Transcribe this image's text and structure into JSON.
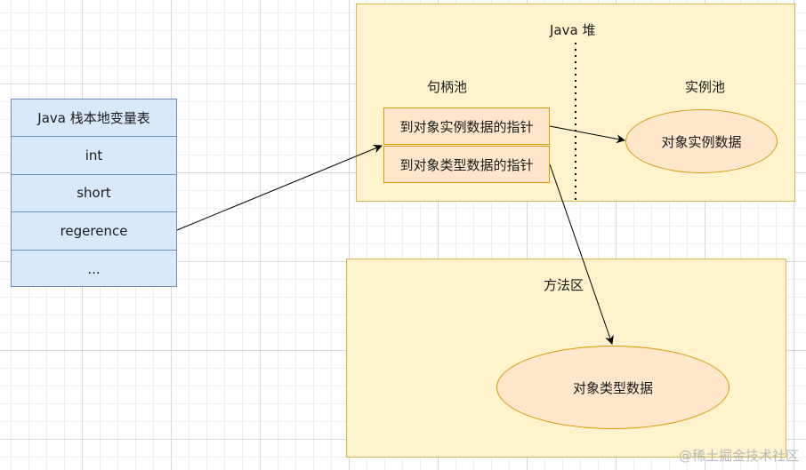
{
  "heap": {
    "title": "Java 堆"
  },
  "handle_pool": {
    "title": "句柄池",
    "items": [
      "到对象实例数据的指针",
      "到对象类型数据的指针"
    ]
  },
  "instance_pool": {
    "title": "实例池",
    "node": "对象实例数据"
  },
  "method_area": {
    "title": "方法区",
    "node": "对象类型数据"
  },
  "stack": {
    "title": "Java 栈本地变量表",
    "rows": [
      "int",
      "short",
      "regerence",
      "..."
    ]
  },
  "watermark": "@稀土掘金技术社区",
  "colors": {
    "region_fill": "#fff2cc",
    "region_border": "#d6b656",
    "node_fill": "#ffe6cc",
    "node_border": "#d79b00",
    "stack_fill": "#dae8fc",
    "stack_border": "#6c8ebf"
  }
}
